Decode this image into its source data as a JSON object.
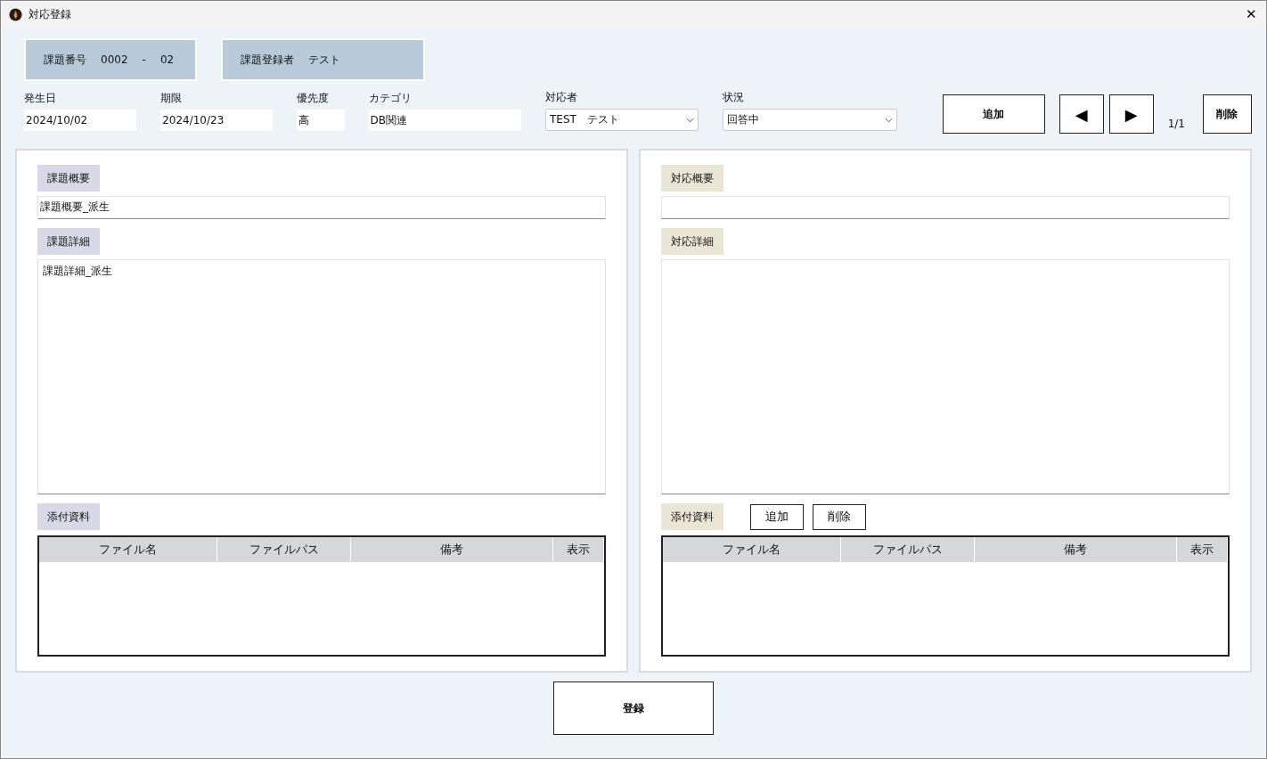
{
  "window": {
    "title": "対応登録",
    "close": "✕"
  },
  "header": {
    "issue_number": {
      "label": "課題番号",
      "value": "0002",
      "separator": "-",
      "branch": "02"
    },
    "registrant": {
      "label": "課題登録者",
      "value": "テスト"
    }
  },
  "fields": [
    {
      "label": "発生日",
      "value": "2024/10/02",
      "kind": "text"
    },
    {
      "label": "期限",
      "value": "2024/10/23",
      "kind": "text"
    },
    {
      "label": "優先度",
      "value": "高",
      "kind": "text"
    },
    {
      "label": "カテゴリ",
      "value": "DB関連",
      "kind": "text"
    },
    {
      "label": "対応者",
      "value": "TEST　テスト",
      "kind": "select"
    },
    {
      "label": "状況",
      "value": "回答中",
      "kind": "select"
    }
  ],
  "toolbar": {
    "add": "追加",
    "prev": "◀",
    "next": "▶",
    "page": "1/1",
    "delete": "削除"
  },
  "panels": [
    {
      "kind": "issue",
      "summary_label": "課題概要",
      "summary": "課題概要_派生",
      "detail_label": "課題詳細",
      "detail": "課題詳細_派生",
      "attachments_label": "添付資料",
      "columns": [
        "ファイル名",
        "ファイルパス",
        "備考",
        "表示"
      ]
    },
    {
      "kind": "response",
      "summary_label": "対応概要",
      "detail_label": "対応詳細",
      "attachments_label": "添付資料",
      "attachment_buttons": [
        "追加",
        "削除"
      ],
      "columns": [
        "ファイル名",
        "ファイルパス",
        "備考",
        "表示"
      ]
    }
  ],
  "submit": "登録"
}
